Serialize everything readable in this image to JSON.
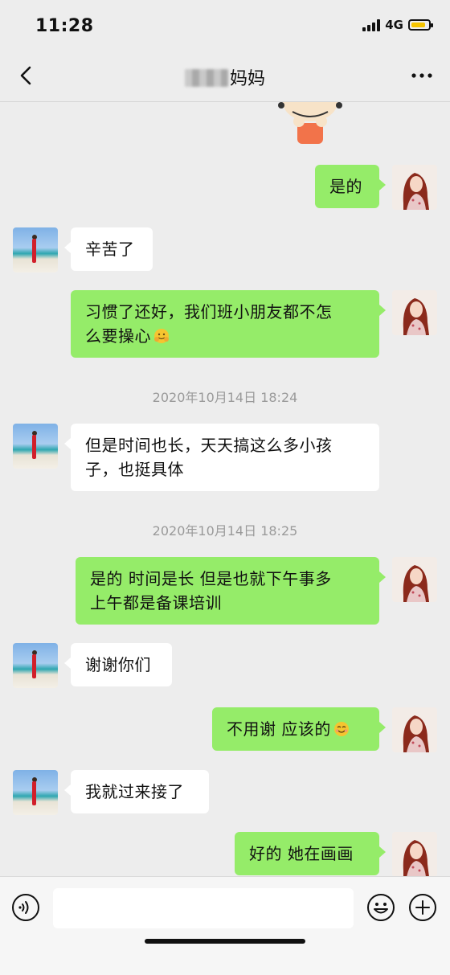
{
  "status": {
    "time": "11:28",
    "network": "4G"
  },
  "header": {
    "title_suffix": "妈妈"
  },
  "messages": [
    {
      "side": "right",
      "text": "是的"
    },
    {
      "side": "left",
      "text": "辛苦了"
    },
    {
      "side": "right",
      "line1": "习惯了还好，我们班小朋友都不怎",
      "line2": "么要操心"
    },
    {
      "side": "left",
      "line1": "但是时间也长，天天搞这么多小孩",
      "line2": "子，也挺具体"
    },
    {
      "side": "right",
      "line1": "是的 时间是长 但是也就下午事多",
      "line2": "上午都是备课培训"
    },
    {
      "side": "left",
      "text": "谢谢你们"
    },
    {
      "side": "right",
      "text": "不用谢 应该的"
    },
    {
      "side": "left",
      "text": "我就过来接了"
    },
    {
      "side": "right",
      "text": "好的 她在画画"
    }
  ],
  "timestamps": [
    "2020年10月14日 18:24",
    "2020年10月14日 18:25"
  ],
  "icons": {
    "back": "back-arrow-icon",
    "more": "more-dots-icon",
    "voice": "voice-icon",
    "emoji": "emoji-icon",
    "plus": "plus-icon"
  },
  "colors": {
    "background": "#ededed",
    "bubble_green": "#95ec69",
    "bubble_white": "#ffffff",
    "timestamp": "#9a9a9a"
  },
  "input": {
    "value": ""
  }
}
